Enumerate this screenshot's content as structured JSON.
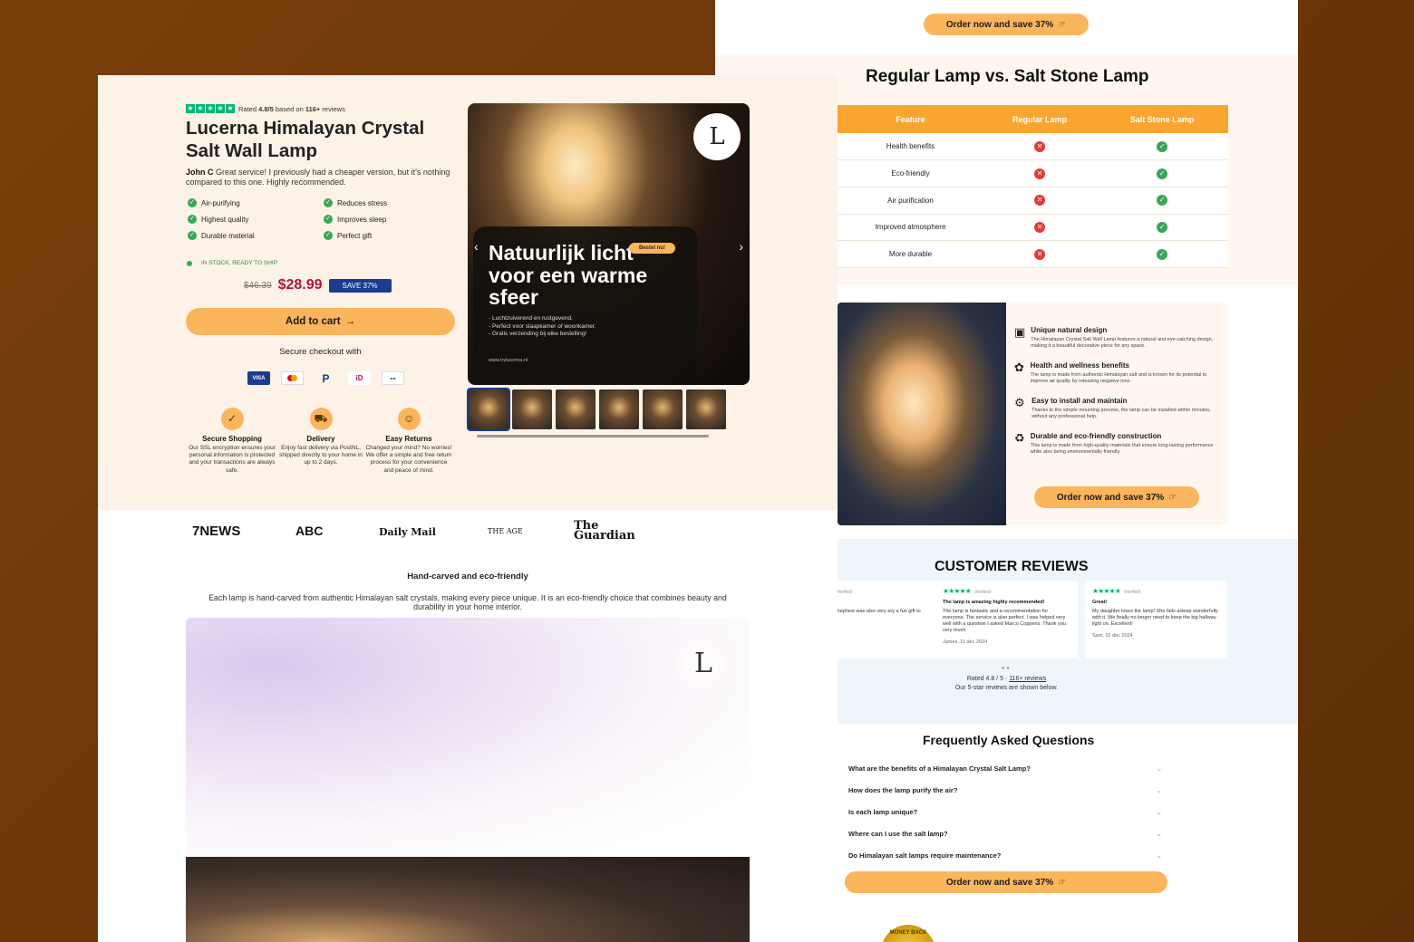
{
  "right": {
    "top_button": "Order now and save 37%",
    "compare": {
      "title": "Regular Lamp vs. Salt Stone Lamp",
      "headers": [
        "Feature",
        "Regular Lamp",
        "Salt Stone Lamp"
      ],
      "rows": [
        "Health benefits",
        "Eco-friendly",
        "Air purification",
        "Improved atmosphere",
        "More durable"
      ]
    },
    "features": {
      "items": [
        {
          "title": "Unique natural design",
          "text": "The Himalayan Crystal Salt Wall Lamp features a natural and eye-catching design, making it a beautiful decorative piece for any space."
        },
        {
          "title": "Health and wellness benefits",
          "text": "The lamp is made from authentic Himalayan salt and is known for its potential to improve air quality by releasing negative ions."
        },
        {
          "title": "Easy to install and maintain",
          "text": "Thanks to the simple mounting process, the lamp can be installed within minutes, without any professional help."
        },
        {
          "title": "Durable and eco-friendly construction",
          "text": "This lamp is made from high-quality materials that ensure long-lasting performance while also being environmentally friendly."
        }
      ],
      "button": "Order now and save 37%"
    },
    "reviews": {
      "title": "CUSTOMER REVIEWS",
      "verified": "Verified",
      "cards": [
        {
          "title": "t delivery",
          "text": "st delivery! My nephew was also very ery a fun gift to give!",
          "author": ""
        },
        {
          "title": "The lamp is amazing highly recommended!",
          "text": "The lamp is fantastic and a recommendation for everyone. The service is also perfect. I was helped very well with a question I asked Marco Coppens. Thank you very much",
          "author": "James, 11 dec 2024"
        },
        {
          "title": "Great!",
          "text": "My daughter loves the lamp! She falls asleep wonderfully with it. We finally no longer need to keep the big hallway light on. Excellent!",
          "author": "Sam, 10 dec 2024"
        }
      ],
      "rated_prefix": "Rated 4.8 / 5 · ",
      "rated_link": "116+ reviews",
      "sub": "Our 5-star reviews are shown below."
    },
    "faq": {
      "title": "Frequently Asked Questions",
      "items": [
        "What are the benefits of a Himalayan Crystal Salt Lamp?",
        "How does the lamp purify the air?",
        "Is each lamp unique?",
        "Where can I use the salt lamp?",
        "Do Himalayan salt lamps require maintenance?"
      ],
      "button": "Order now and save 37%",
      "seal": "MONEY BACK"
    }
  },
  "left": {
    "rating": {
      "prefix": "Rated ",
      "score": "4.8/5",
      "middle": " based on ",
      "count": "116+",
      "suffix": " reviews"
    },
    "title": "Lucerna Himalayan Crystal Salt Wall Lamp",
    "review_author": "John C",
    "review_text": " Great service! I previously had a cheaper version, but it's nothing compared to this one. Highly recommended.",
    "benefits": [
      "Air-purifying",
      "Reduces stress",
      "Highest quality",
      "Improves sleep",
      "Durable material",
      "Perfect gift"
    ],
    "stock": "IN STOCK, READY TO SHIP",
    "old_price": "$46.39",
    "price": "$28.99",
    "save": "SAVE 37%",
    "cart": "Add to cart",
    "secure": "Secure checkout with",
    "payments": [
      "VISA",
      "Mastercard",
      "PayPal",
      "iDEAL",
      "Bancontact"
    ],
    "trust": [
      {
        "title": "Secure Shopping",
        "text": "Our SSL encryption ensures your personal information is protected and your transactions are always safe."
      },
      {
        "title": "Delivery",
        "text": "Enjoy fast delivery via PostNL, shipped directly to your home in up to 2 days."
      },
      {
        "title": "Easy Returns",
        "text": "Changed your mind? No worries! We offer a simple and free return process for your convenience and peace of mind."
      }
    ],
    "gallery": {
      "logo": "L",
      "headline": "Natuurlijk licht voor een warme sfeer",
      "badge": "Bestel nu!",
      "bullets": [
        "- Luchtzuiverend en rustgevend.",
        "- Perfect voor slaapkamer of woonkamer.",
        "- Gratis verzending bij elke bestelling!"
      ],
      "url": "www.trylucerna.nl"
    },
    "press": [
      "7NEWS",
      "ABC",
      "Daily Mail",
      "THE AGE",
      "The Guardian"
    ],
    "section_title": "Hand-carved and eco-friendly",
    "section_text": "Each lamp is hand-carved from authentic Himalayan salt crystals, making every piece unique. It is an eco-friendly choice that combines beauty and durability in your home interior.",
    "banner_logo": "L"
  }
}
